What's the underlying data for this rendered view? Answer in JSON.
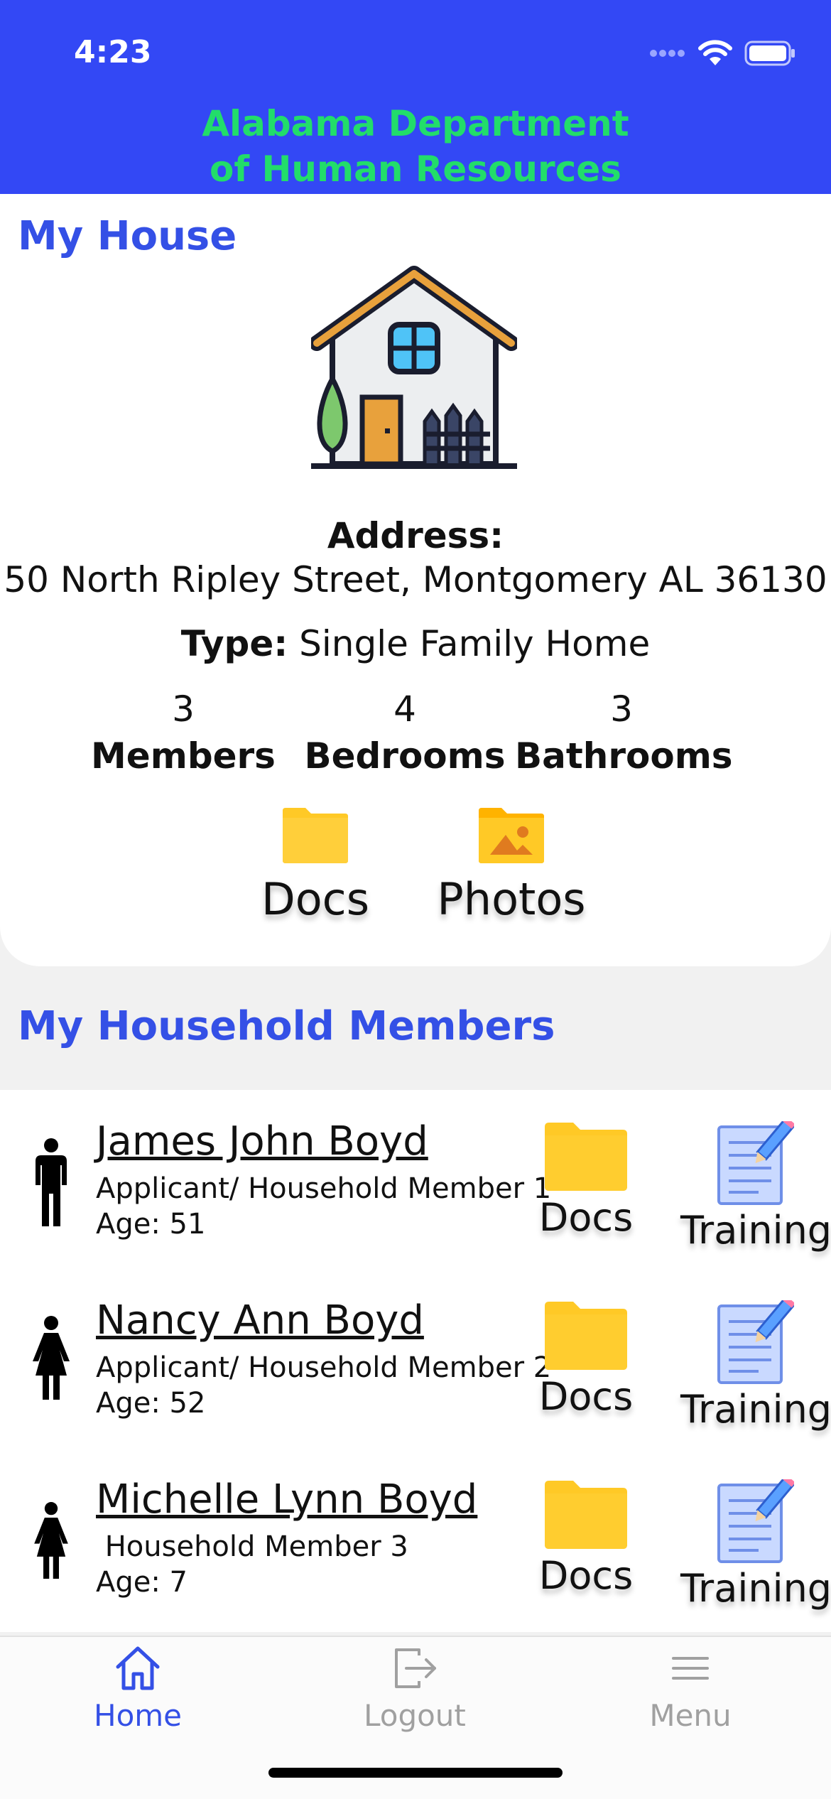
{
  "status_bar": {
    "time": "4:23"
  },
  "header": {
    "title_line1": "Alabama Department",
    "title_line2": "of Human Resources"
  },
  "house": {
    "section_title": "My House",
    "address_label": "Address:",
    "address": "50 North Ripley Street, Montgomery AL 36130",
    "type_label": "Type:",
    "type_value": "Single Family Home",
    "stats": [
      {
        "value": "3",
        "label": "Members"
      },
      {
        "value": "4",
        "label": "Bedrooms"
      },
      {
        "value": "3",
        "label": "Bathrooms"
      }
    ],
    "docs_label": "Docs",
    "photos_label": "Photos"
  },
  "members": {
    "section_title": "My Household Members",
    "items": [
      {
        "name": "James John Boyd",
        "role": "Applicant/ Household Member 1",
        "age": "Age: 51",
        "gender": "male",
        "docs_label": "Docs",
        "training_label": "Training"
      },
      {
        "name": "Nancy Ann Boyd",
        "role": "Applicant/ Household Member 2",
        "age": "Age: 52",
        "gender": "female",
        "docs_label": "Docs",
        "training_label": "Training"
      },
      {
        "name": "Michelle Lynn Boyd",
        "role": " Household Member 3",
        "age": "Age: 7",
        "gender": "female",
        "docs_label": "Docs",
        "training_label": "Training"
      }
    ]
  },
  "tabbar": {
    "home": "Home",
    "logout": "Logout",
    "menu": "Menu",
    "active": "home"
  },
  "colors": {
    "header_bg": "#3348f5",
    "header_text": "#22dd6a",
    "accent": "#3450e6",
    "folder": "#ffc926",
    "inactive_tab": "#a0a0a0"
  }
}
